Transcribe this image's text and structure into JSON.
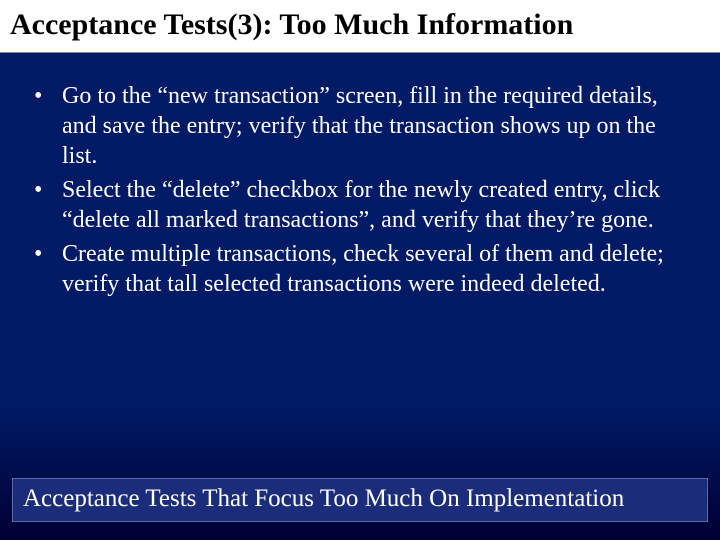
{
  "title": "Acceptance Tests(3): Too Much Information",
  "bullets": [
    "Go to the “new transaction” screen, fill in the required details, and save the entry; verify that the transaction shows up on the list.",
    "Select the “delete” checkbox for the newly created entry, click “delete all marked transactions”, and verify that they’re gone.",
    "Create multiple transactions, check several of them and delete; verify that tall selected transactions were indeed deleted."
  ],
  "footer": "Acceptance Tests That Focus Too Much On Implementation"
}
